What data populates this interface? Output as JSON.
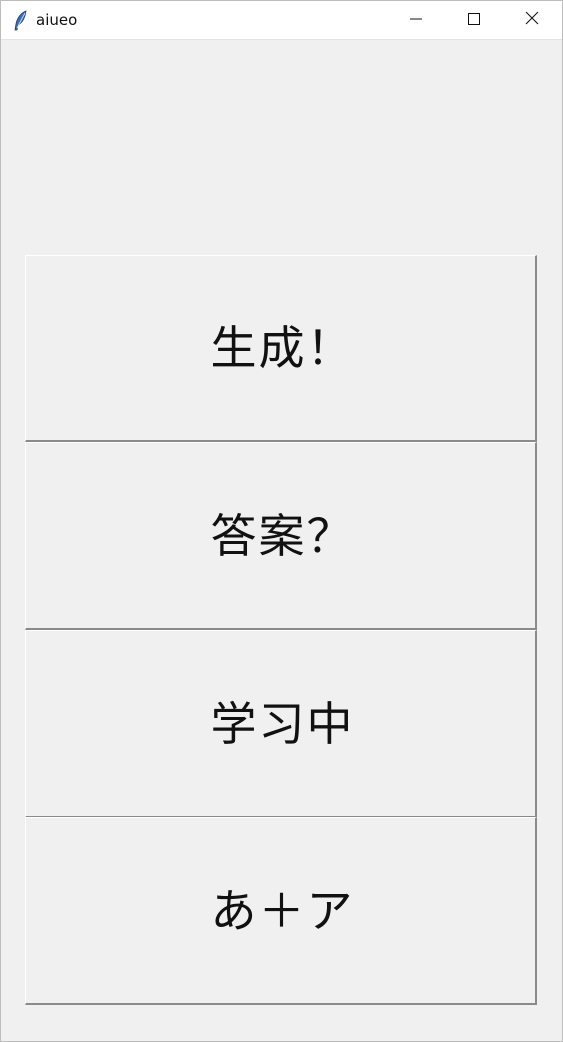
{
  "window": {
    "title": "aiueo",
    "icon": "feather-icon",
    "controls": {
      "minimize_icon": "minimize-icon",
      "maximize_icon": "maximize-icon",
      "close_icon": "close-icon"
    }
  },
  "buttons": [
    {
      "label": "生成！"
    },
    {
      "label": "答案？"
    },
    {
      "label": "学习中"
    },
    {
      "label": "あ＋ア"
    }
  ],
  "colors": {
    "background": "#f0f0f0",
    "titlebar": "#ffffff",
    "button_shadow": "#8a8a8a",
    "text": "#111111"
  }
}
